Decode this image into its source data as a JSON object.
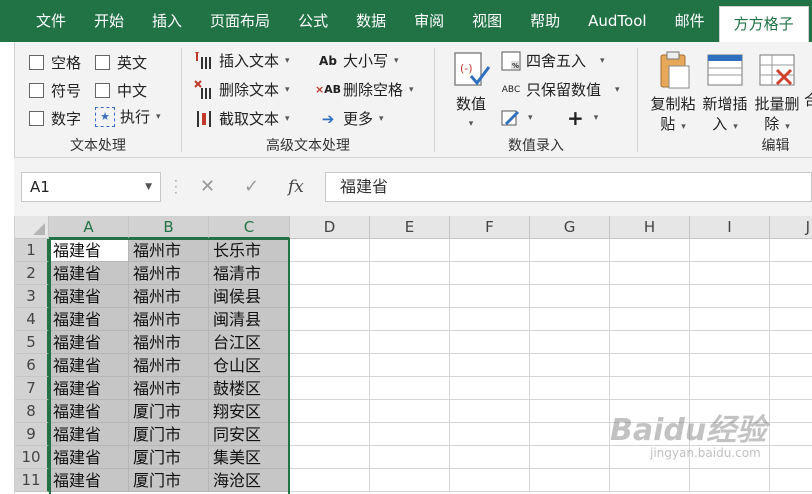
{
  "menu": {
    "tabs": [
      "文件",
      "开始",
      "插入",
      "页面布局",
      "公式",
      "数据",
      "审阅",
      "视图",
      "帮助",
      "AudTool",
      "邮件",
      "方方格子"
    ],
    "active_index": 11
  },
  "ribbon": {
    "text_group": {
      "label": "文本处理",
      "checkboxes": [
        "空格",
        "英文",
        "符号",
        "中文",
        "数字"
      ],
      "exec_label": "执行"
    },
    "adv_group": {
      "label": "高级文本处理",
      "insert_text": "插入文本",
      "delete_text": "删除文本",
      "extract_text": "截取文本",
      "case": "大小写",
      "delete_space": "删除空格",
      "more": "更多"
    },
    "num_group": {
      "label": "数值录入",
      "value_btn": "数值",
      "round": "四舍五入",
      "keep_value": "只保留数值",
      "plus": "+"
    },
    "edit_group": {
      "label": "编辑",
      "copy_paste_l1": "复制粘",
      "copy_paste_l2": "贴",
      "add_insert_l1": "新增插",
      "add_insert_l2": "入",
      "batch_delete_l1": "批量删",
      "batch_delete_l2": "除",
      "cut_off": "合"
    }
  },
  "formula_bar": {
    "name_box": "A1",
    "fx": "fx",
    "value": "福建省"
  },
  "sheet": {
    "columns": [
      "A",
      "B",
      "C",
      "D",
      "E",
      "F",
      "G",
      "H",
      "I",
      "J"
    ],
    "rows": [
      {
        "n": "1",
        "a": "福建省",
        "b": "福州市",
        "c": "长乐市"
      },
      {
        "n": "2",
        "a": "福建省",
        "b": "福州市",
        "c": "福清市"
      },
      {
        "n": "3",
        "a": "福建省",
        "b": "福州市",
        "c": "闽侯县"
      },
      {
        "n": "4",
        "a": "福建省",
        "b": "福州市",
        "c": "闽清县"
      },
      {
        "n": "5",
        "a": "福建省",
        "b": "福州市",
        "c": "台江区"
      },
      {
        "n": "6",
        "a": "福建省",
        "b": "福州市",
        "c": "仓山区"
      },
      {
        "n": "7",
        "a": "福建省",
        "b": "福州市",
        "c": "鼓楼区"
      },
      {
        "n": "8",
        "a": "福建省",
        "b": "厦门市",
        "c": "翔安区"
      },
      {
        "n": "9",
        "a": "福建省",
        "b": "厦门市",
        "c": "同安区"
      },
      {
        "n": "10",
        "a": "福建省",
        "b": "厦门市",
        "c": "集美区"
      },
      {
        "n": "11",
        "a": "福建省",
        "b": "厦门市",
        "c": "海沧区"
      }
    ]
  },
  "watermark": {
    "main": "Baidu经验",
    "sub": "jingyan.baidu.com"
  },
  "colors": {
    "accent": "#217346",
    "selection": "#c6c6c6"
  }
}
